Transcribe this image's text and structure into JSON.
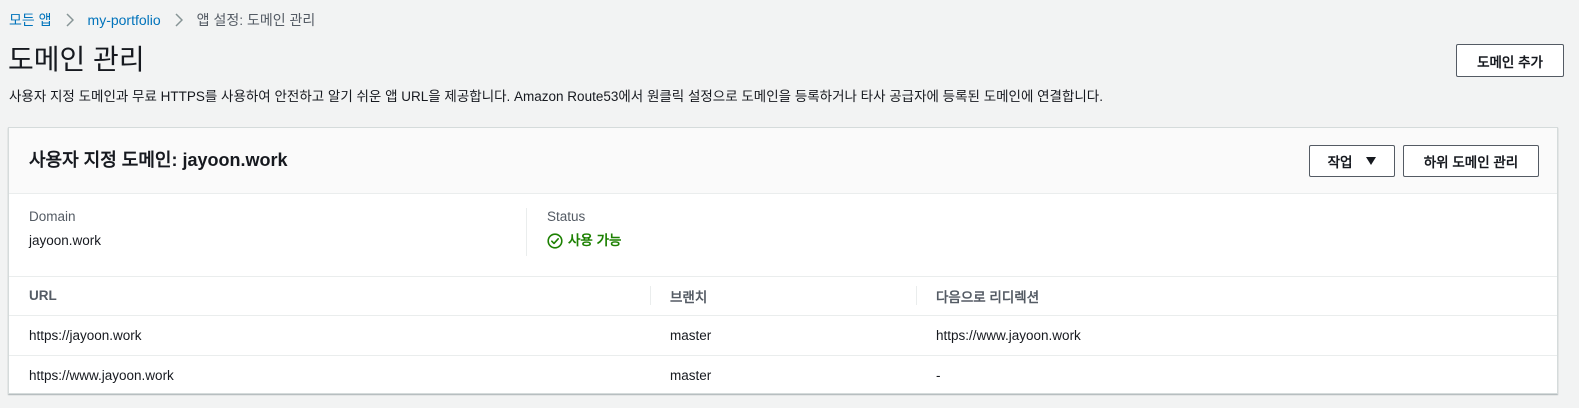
{
  "breadcrumb": {
    "items": [
      "모든 앱",
      "my-portfolio",
      "앱 설정: 도메인 관리"
    ]
  },
  "page": {
    "title": "도메인 관리",
    "description": "사용자 지정 도메인과 무료 HTTPS를 사용하여 안전하고 알기 쉬운 앱 URL을 제공합니다. Amazon Route53에서 원클릭 설정으로 도메인을 등록하거나 타사 공급자에 등록된 도메인에 연결합니다.",
    "add_domain_label": "도메인 추가"
  },
  "panel": {
    "title": "사용자 지정 도메인: jayoon.work",
    "actions_label": "작업",
    "manage_subdomains_label": "하위 도메인 관리",
    "summary": {
      "domain_label": "Domain",
      "domain_value": "jayoon.work",
      "status_label": "Status",
      "status_value": "사용 가능",
      "status_color": "#1d8102"
    },
    "table": {
      "headers": [
        "URL",
        "브랜치",
        "다음으로 리디렉션"
      ],
      "rows": [
        [
          "https://jayoon.work",
          "master",
          "https://www.jayoon.work"
        ],
        [
          "https://www.jayoon.work",
          "master",
          "-"
        ]
      ]
    }
  },
  "colors": {
    "link": "#0073bb",
    "background": "#f2f3f3",
    "success": "#1d8102"
  }
}
